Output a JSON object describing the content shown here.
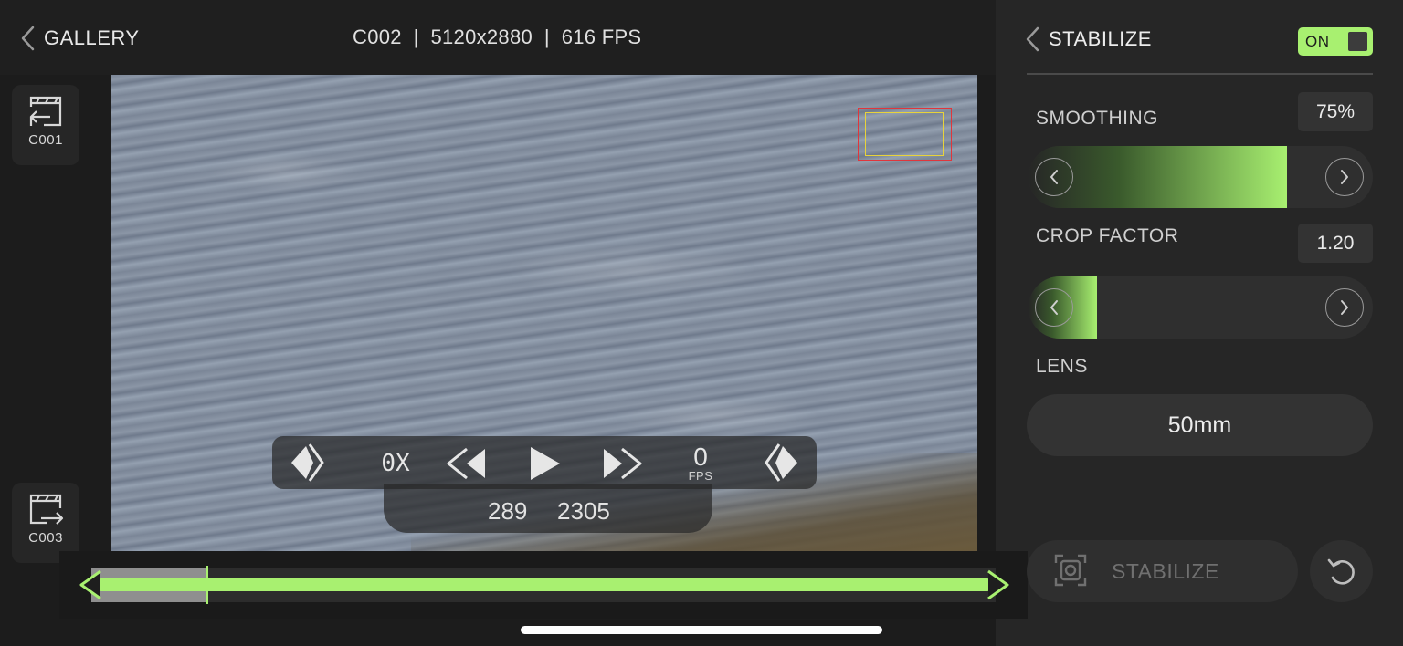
{
  "header": {
    "back_label": "GALLERY",
    "clip_info": "C002  |  5120x2880  |  616 FPS"
  },
  "clip_nav": {
    "previous_label": "C001",
    "next_label": "C003"
  },
  "playback": {
    "speed": "0X",
    "fps_value": "0",
    "fps_unit": "FPS",
    "in_frame": "289",
    "out_frame": "2305"
  },
  "timeline": {
    "accent_color": "#a8f070"
  },
  "panel": {
    "title": "STABILIZE",
    "toggle_label": "ON",
    "smoothing": {
      "label": "SMOOTHING",
      "value": "75%",
      "level": 0.75
    },
    "crop_factor": {
      "label": "CROP FACTOR",
      "value": "1.20",
      "level": 0.2
    },
    "lens": {
      "label": "LENS",
      "value": "50mm"
    },
    "stabilize_button": "STABILIZE"
  },
  "icons": {
    "back": "chevron-left-icon",
    "previous_clip": "clip-previous-icon",
    "next_clip": "clip-next-icon",
    "mark_in": "mark-in-icon",
    "rewind": "rewind-icon",
    "play": "play-icon",
    "forward": "fast-forward-icon",
    "mark_out": "mark-out-icon",
    "stabilize": "stabilize-frame-icon",
    "reset": "reset-icon"
  },
  "colors": {
    "accent": "#a8f070",
    "roi_outer": "#e0363c",
    "roi_inner": "#e8d33a"
  }
}
